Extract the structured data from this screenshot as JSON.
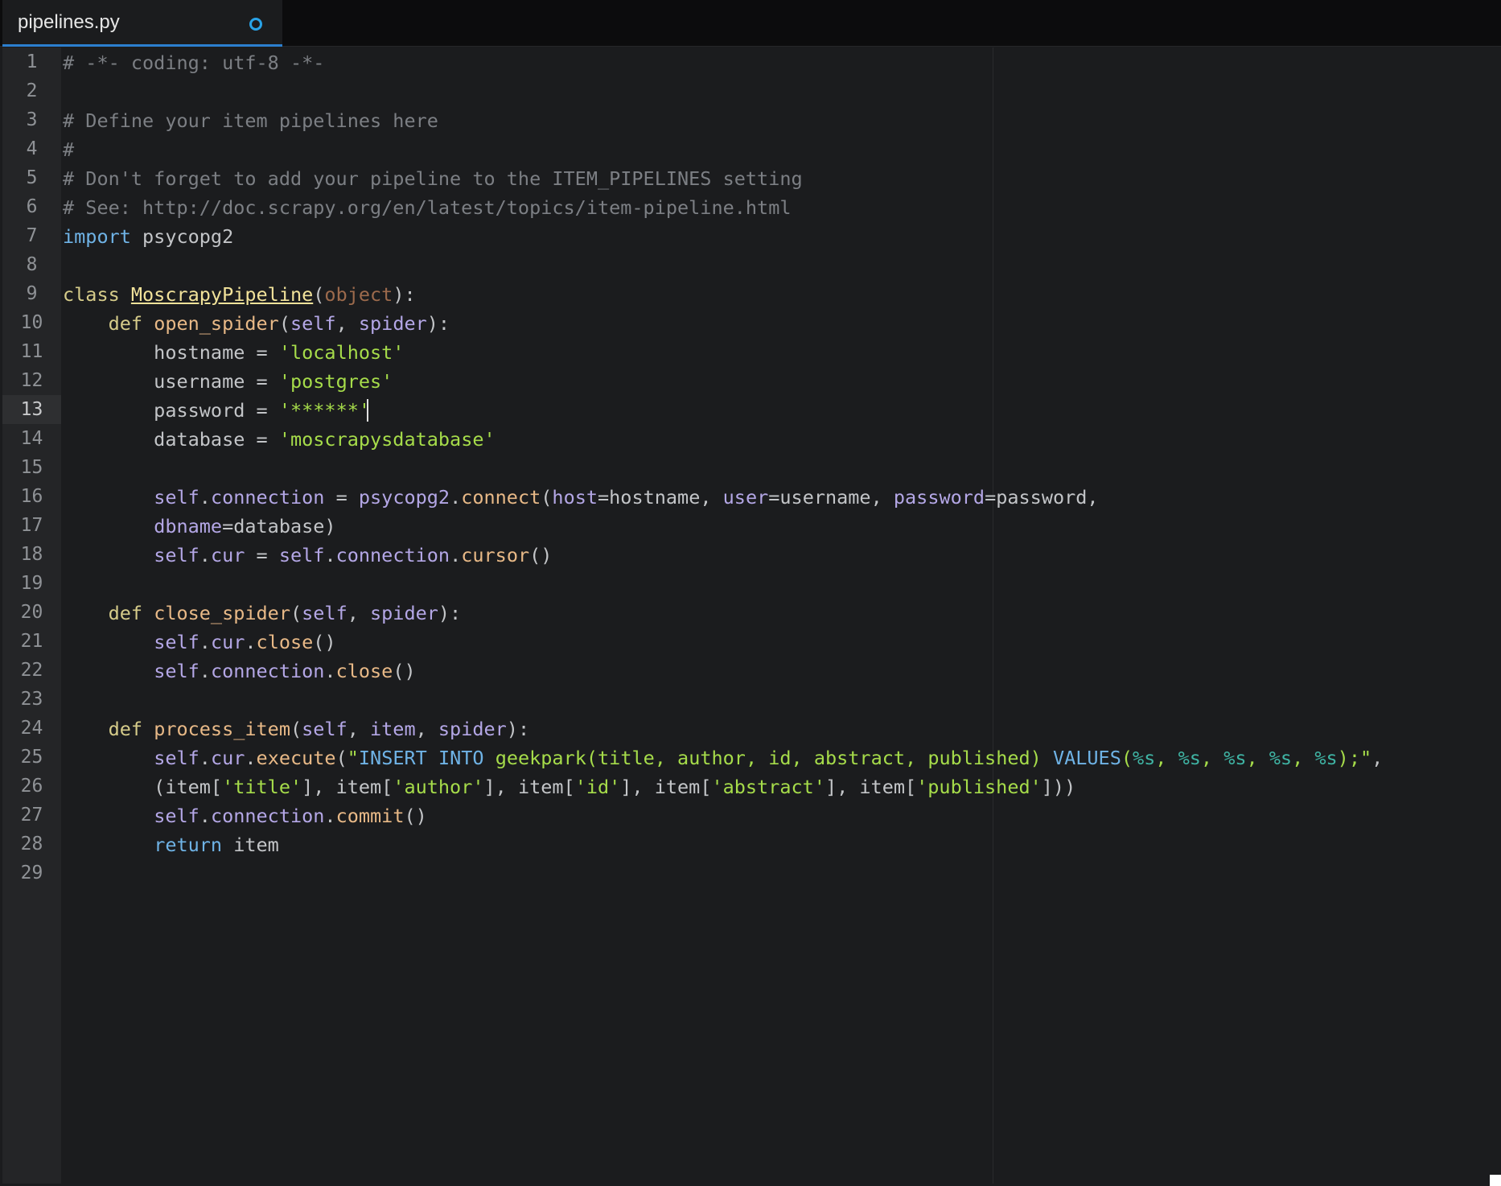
{
  "tab": {
    "title": "pipelines.py",
    "modified": true
  },
  "editor": {
    "active_line": 13,
    "colors": {
      "comment": "#7c7f84",
      "keyword": "#6fb3e6",
      "def_keyword": "#d6cc8a",
      "class_name": "#f1e29a",
      "function": "#e8b987",
      "self": "#b4a7e6",
      "string": "#a6dc4a",
      "builtin": "#9c6a4c",
      "format": "#3fb4a4",
      "plain": "#c3c5c8"
    },
    "lines": [
      {
        "n": "1",
        "tokens": [
          {
            "t": "# -*- coding: utf-8 -*-",
            "c": "comment"
          }
        ]
      },
      {
        "n": "2",
        "tokens": []
      },
      {
        "n": "3",
        "tokens": [
          {
            "t": "# Define your item pipelines here",
            "c": "comment"
          }
        ]
      },
      {
        "n": "4",
        "tokens": [
          {
            "t": "#",
            "c": "comment"
          }
        ]
      },
      {
        "n": "5",
        "tokens": [
          {
            "t": "# Don't forget to add your pipeline to the ITEM_PIPELINES setting",
            "c": "comment"
          }
        ]
      },
      {
        "n": "6",
        "tokens": [
          {
            "t": "# See: http://doc.scrapy.org/en/latest/topics/item-pipeline.html",
            "c": "comment"
          }
        ]
      },
      {
        "n": "7",
        "tokens": [
          {
            "t": "import",
            "c": "keyword"
          },
          {
            "t": " psycopg2",
            "c": "plain"
          }
        ]
      },
      {
        "n": "8",
        "tokens": []
      },
      {
        "n": "9",
        "tokens": [
          {
            "t": "class ",
            "c": "def_keyword"
          },
          {
            "t": "MoscrapyPipeline",
            "c": "class_name",
            "u": true
          },
          {
            "t": "(",
            "c": "plain"
          },
          {
            "t": "object",
            "c": "builtin"
          },
          {
            "t": "):",
            "c": "plain"
          }
        ]
      },
      {
        "n": "10",
        "tokens": [
          {
            "t": "    def ",
            "c": "def_keyword"
          },
          {
            "t": "open_spider",
            "c": "function"
          },
          {
            "t": "(",
            "c": "plain"
          },
          {
            "t": "self",
            "c": "self"
          },
          {
            "t": ", ",
            "c": "plain"
          },
          {
            "t": "spider",
            "c": "self"
          },
          {
            "t": "):",
            "c": "plain"
          }
        ]
      },
      {
        "n": "11",
        "tokens": [
          {
            "t": "        hostname = ",
            "c": "plain"
          },
          {
            "t": "'localhost'",
            "c": "string"
          }
        ]
      },
      {
        "n": "12",
        "tokens": [
          {
            "t": "        username = ",
            "c": "plain"
          },
          {
            "t": "'postgres'",
            "c": "string"
          }
        ]
      },
      {
        "n": "13",
        "tokens": [
          {
            "t": "        password = ",
            "c": "plain"
          },
          {
            "t": "'******'",
            "c": "string"
          }
        ]
      },
      {
        "n": "14",
        "tokens": [
          {
            "t": "        database = ",
            "c": "plain"
          },
          {
            "t": "'moscrapysdatabase'",
            "c": "string"
          }
        ]
      },
      {
        "n": "15",
        "tokens": []
      },
      {
        "n": "16",
        "tokens": [
          {
            "t": "        ",
            "c": "plain"
          },
          {
            "t": "self",
            "c": "self"
          },
          {
            "t": ".",
            "c": "plain"
          },
          {
            "t": "connection",
            "c": "self"
          },
          {
            "t": " = ",
            "c": "plain"
          },
          {
            "t": "psycopg2",
            "c": "self"
          },
          {
            "t": ".",
            "c": "plain"
          },
          {
            "t": "connect",
            "c": "function"
          },
          {
            "t": "(",
            "c": "plain"
          },
          {
            "t": "host",
            "c": "self"
          },
          {
            "t": "=hostname, ",
            "c": "plain"
          },
          {
            "t": "user",
            "c": "self"
          },
          {
            "t": "=username, ",
            "c": "plain"
          },
          {
            "t": "password",
            "c": "self"
          },
          {
            "t": "=password,",
            "c": "plain"
          }
        ]
      },
      {
        "n": "17",
        "tokens": [
          {
            "t": "        ",
            "c": "plain"
          },
          {
            "t": "dbname",
            "c": "self"
          },
          {
            "t": "=database)",
            "c": "plain"
          }
        ]
      },
      {
        "n": "18",
        "tokens": [
          {
            "t": "        ",
            "c": "plain"
          },
          {
            "t": "self",
            "c": "self"
          },
          {
            "t": ".",
            "c": "plain"
          },
          {
            "t": "cur",
            "c": "self"
          },
          {
            "t": " = ",
            "c": "plain"
          },
          {
            "t": "self",
            "c": "self"
          },
          {
            "t": ".",
            "c": "plain"
          },
          {
            "t": "connection",
            "c": "self"
          },
          {
            "t": ".",
            "c": "plain"
          },
          {
            "t": "cursor",
            "c": "function"
          },
          {
            "t": "()",
            "c": "plain"
          }
        ]
      },
      {
        "n": "19",
        "tokens": []
      },
      {
        "n": "20",
        "tokens": [
          {
            "t": "    def ",
            "c": "def_keyword"
          },
          {
            "t": "close_spider",
            "c": "function"
          },
          {
            "t": "(",
            "c": "plain"
          },
          {
            "t": "self",
            "c": "self"
          },
          {
            "t": ", ",
            "c": "plain"
          },
          {
            "t": "spider",
            "c": "self"
          },
          {
            "t": "):",
            "c": "plain"
          }
        ]
      },
      {
        "n": "21",
        "tokens": [
          {
            "t": "        ",
            "c": "plain"
          },
          {
            "t": "self",
            "c": "self"
          },
          {
            "t": ".",
            "c": "plain"
          },
          {
            "t": "cur",
            "c": "self"
          },
          {
            "t": ".",
            "c": "plain"
          },
          {
            "t": "close",
            "c": "function"
          },
          {
            "t": "()",
            "c": "plain"
          }
        ]
      },
      {
        "n": "22",
        "tokens": [
          {
            "t": "        ",
            "c": "plain"
          },
          {
            "t": "self",
            "c": "self"
          },
          {
            "t": ".",
            "c": "plain"
          },
          {
            "t": "connection",
            "c": "self"
          },
          {
            "t": ".",
            "c": "plain"
          },
          {
            "t": "close",
            "c": "function"
          },
          {
            "t": "()",
            "c": "plain"
          }
        ]
      },
      {
        "n": "23",
        "tokens": []
      },
      {
        "n": "24",
        "tokens": [
          {
            "t": "    def ",
            "c": "def_keyword"
          },
          {
            "t": "process_item",
            "c": "function"
          },
          {
            "t": "(",
            "c": "plain"
          },
          {
            "t": "self",
            "c": "self"
          },
          {
            "t": ", ",
            "c": "plain"
          },
          {
            "t": "item",
            "c": "self"
          },
          {
            "t": ", ",
            "c": "plain"
          },
          {
            "t": "spider",
            "c": "self"
          },
          {
            "t": "):",
            "c": "plain"
          }
        ]
      },
      {
        "n": "25",
        "tokens": [
          {
            "t": "        ",
            "c": "plain"
          },
          {
            "t": "self",
            "c": "self"
          },
          {
            "t": ".",
            "c": "plain"
          },
          {
            "t": "cur",
            "c": "self"
          },
          {
            "t": ".",
            "c": "plain"
          },
          {
            "t": "execute",
            "c": "function"
          },
          {
            "t": "(",
            "c": "plain"
          },
          {
            "t": "\"",
            "c": "string"
          },
          {
            "t": "INSERT INTO ",
            "c": "keyword"
          },
          {
            "t": "geekpark(title, author, id, abstract, published) ",
            "c": "string"
          },
          {
            "t": "VALUES",
            "c": "keyword"
          },
          {
            "t": "(",
            "c": "string"
          },
          {
            "t": "%s",
            "c": "format"
          },
          {
            "t": ", ",
            "c": "string"
          },
          {
            "t": "%s",
            "c": "format"
          },
          {
            "t": ", ",
            "c": "string"
          },
          {
            "t": "%s",
            "c": "format"
          },
          {
            "t": ", ",
            "c": "string"
          },
          {
            "t": "%s",
            "c": "format"
          },
          {
            "t": ", ",
            "c": "string"
          },
          {
            "t": "%s",
            "c": "format"
          },
          {
            "t": ");\"",
            "c": "string"
          },
          {
            "t": ",",
            "c": "plain"
          }
        ]
      },
      {
        "n": "26",
        "tokens": [
          {
            "t": "        (item[",
            "c": "plain"
          },
          {
            "t": "'title'",
            "c": "string"
          },
          {
            "t": "], item[",
            "c": "plain"
          },
          {
            "t": "'author'",
            "c": "string"
          },
          {
            "t": "], item[",
            "c": "plain"
          },
          {
            "t": "'id'",
            "c": "string"
          },
          {
            "t": "], item[",
            "c": "plain"
          },
          {
            "t": "'abstract'",
            "c": "string"
          },
          {
            "t": "], item[",
            "c": "plain"
          },
          {
            "t": "'published'",
            "c": "string"
          },
          {
            "t": "]))",
            "c": "plain"
          }
        ]
      },
      {
        "n": "27",
        "tokens": [
          {
            "t": "        ",
            "c": "plain"
          },
          {
            "t": "self",
            "c": "self"
          },
          {
            "t": ".",
            "c": "plain"
          },
          {
            "t": "connection",
            "c": "self"
          },
          {
            "t": ".",
            "c": "plain"
          },
          {
            "t": "commit",
            "c": "function"
          },
          {
            "t": "()",
            "c": "plain"
          }
        ]
      },
      {
        "n": "28",
        "tokens": [
          {
            "t": "        ",
            "c": "plain"
          },
          {
            "t": "return",
            "c": "keyword"
          },
          {
            "t": " item",
            "c": "plain"
          }
        ]
      },
      {
        "n": "29",
        "tokens": []
      }
    ]
  }
}
